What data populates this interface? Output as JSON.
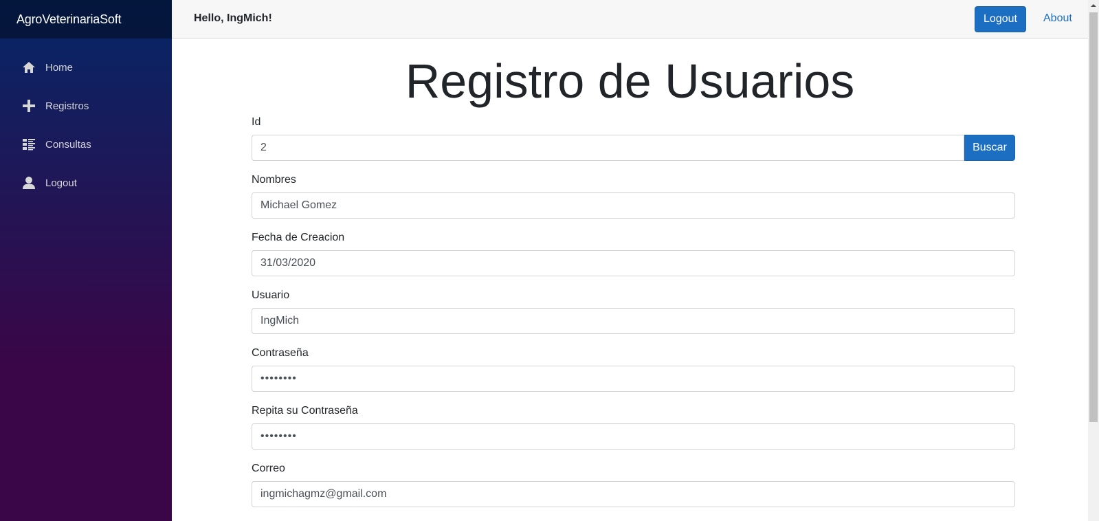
{
  "sidebar": {
    "brand": "AgroVeterinariaSoft",
    "items": [
      {
        "label": "Home",
        "icon": "home-icon"
      },
      {
        "label": "Registros",
        "icon": "plus-icon"
      },
      {
        "label": "Consultas",
        "icon": "list-icon"
      },
      {
        "label": "Logout",
        "icon": "person-icon"
      }
    ]
  },
  "topbar": {
    "greeting": "Hello, IngMich!",
    "logout_label": "Logout",
    "about_label": "About"
  },
  "main": {
    "title": "Registro de Usuarios",
    "buscar_label": "Buscar",
    "fields": {
      "id": {
        "label": "Id",
        "value": "2"
      },
      "nombres": {
        "label": "Nombres",
        "value": "Michael Gomez"
      },
      "fecha": {
        "label": "Fecha de Creacion",
        "value": "31/03/2020"
      },
      "usuario": {
        "label": "Usuario",
        "value": "IngMich"
      },
      "contrasena": {
        "label": "Contraseña",
        "value": "••••••••"
      },
      "repita": {
        "label": "Repita su Contraseña",
        "value": "••••••••"
      },
      "correo": {
        "label": "Correo",
        "value": "ingmichagmz@gmail.com"
      }
    }
  },
  "colors": {
    "accent": "#1b6ec2",
    "sidebar_top": "#052767",
    "sidebar_bottom": "#3a0647"
  }
}
